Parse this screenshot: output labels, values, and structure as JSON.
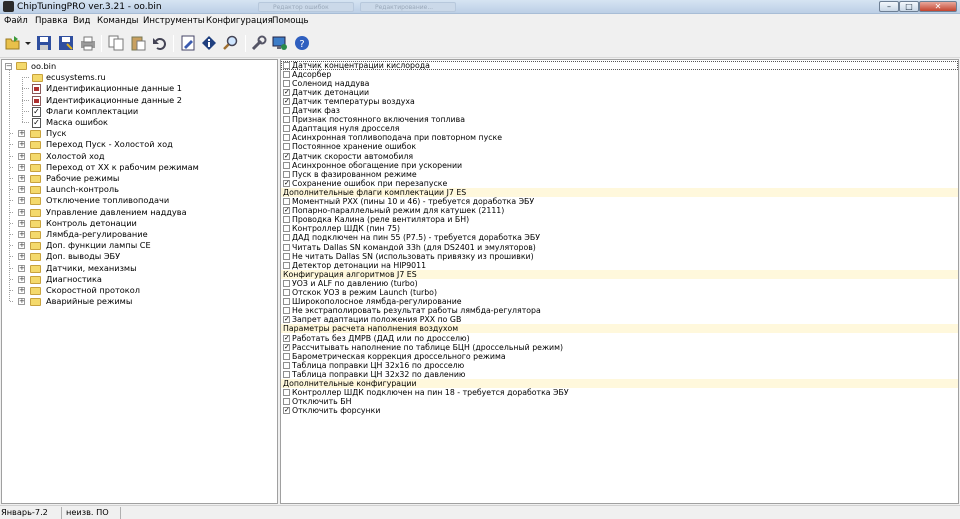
{
  "window": {
    "title": "ChipTuningPRO ver.3.21 - oo.bin",
    "ghost_tabs": [
      "Редактор ошибок",
      "Редактирование..."
    ],
    "controls": {
      "minimize": "–",
      "maximize": "□",
      "close": "✕"
    }
  },
  "menu": [
    "Файл",
    "Правка",
    "Вид",
    "Команды",
    "Инструменты",
    "Конфигурация",
    "Помощь"
  ],
  "toolbar": {
    "icons": [
      "open-icon",
      "dropdown-arrow-icon",
      "save-icon",
      "save-as-icon",
      "print-icon",
      "copy-icon",
      "paste-icon",
      "undo-icon",
      "edit-icon",
      "info-icon",
      "search-icon",
      "tools-icon",
      "monitor-icon",
      "help-icon"
    ]
  },
  "tree": {
    "root": "oo.bin",
    "children": [
      {
        "label": "ecusystems.ru",
        "kind": "folder",
        "expandable": false
      },
      {
        "label": "Идентификационные данные 1",
        "kind": "doc",
        "expandable": false
      },
      {
        "label": "Идентификационные данные 2",
        "kind": "doc",
        "expandable": false
      },
      {
        "label": "Флаги комплектации",
        "kind": "check",
        "expandable": false
      },
      {
        "label": "Маска ошибок",
        "kind": "check",
        "expandable": false
      },
      {
        "label": "Пуск",
        "kind": "folder",
        "expandable": true
      },
      {
        "label": "Переход Пуск - Холостой ход",
        "kind": "folder",
        "expandable": true
      },
      {
        "label": "Холостой ход",
        "kind": "folder",
        "expandable": true
      },
      {
        "label": "Переход от ХХ к рабочим режимам",
        "kind": "folder",
        "expandable": true
      },
      {
        "label": "Рабочие режимы",
        "kind": "folder",
        "expandable": true
      },
      {
        "label": "Launch-контроль",
        "kind": "folder",
        "expandable": true
      },
      {
        "label": "Отключение топливоподачи",
        "kind": "folder",
        "expandable": true
      },
      {
        "label": "Управление давлением наддува",
        "kind": "folder",
        "expandable": true
      },
      {
        "label": "Контроль детонации",
        "kind": "folder",
        "expandable": true
      },
      {
        "label": "Лямбда-регулирование",
        "kind": "folder",
        "expandable": true
      },
      {
        "label": "Доп. функции лампы CE",
        "kind": "folder",
        "expandable": true
      },
      {
        "label": "Доп. выводы ЭБУ",
        "kind": "folder",
        "expandable": true
      },
      {
        "label": "Датчики, механизмы",
        "kind": "folder",
        "expandable": true
      },
      {
        "label": "Диагностика",
        "kind": "folder",
        "expandable": true
      },
      {
        "label": "Скоростной протокол",
        "kind": "folder",
        "expandable": true
      },
      {
        "label": "Аварийные режимы",
        "kind": "folder",
        "expandable": true
      }
    ]
  },
  "flags": [
    {
      "type": "item",
      "label": "Датчик концентрации кислорода",
      "checked": false
    },
    {
      "type": "item",
      "label": "Адсорбер",
      "checked": false
    },
    {
      "type": "item",
      "label": "Соленоид наддува",
      "checked": false
    },
    {
      "type": "item",
      "label": "Датчик детонации",
      "checked": true
    },
    {
      "type": "item",
      "label": "Датчик температуры воздуха",
      "checked": true
    },
    {
      "type": "item",
      "label": "Датчик фаз",
      "checked": false
    },
    {
      "type": "item",
      "label": "Признак постоянного включения топлива",
      "checked": false
    },
    {
      "type": "item",
      "label": "Адаптация нуля дросселя",
      "checked": false
    },
    {
      "type": "item",
      "label": "Асинхронная топливоподача при повторном пуске",
      "checked": false
    },
    {
      "type": "item",
      "label": "Постоянное хранение ошибок",
      "checked": false
    },
    {
      "type": "item",
      "label": "Датчик скорости автомобиля",
      "checked": true
    },
    {
      "type": "item",
      "label": "Асинхронное обогащение при ускорении",
      "checked": false
    },
    {
      "type": "item",
      "label": "Пуск в фазированном режиме",
      "checked": false
    },
    {
      "type": "item",
      "label": "Сохранение ошибок при перезапуске",
      "checked": true
    },
    {
      "type": "section",
      "label": "Дополнительные флаги комплектации J7 ES"
    },
    {
      "type": "item",
      "label": "Моментный РХХ (пины 10 и 46) - требуется доработка ЭБУ",
      "checked": false
    },
    {
      "type": "item",
      "label": "Попарно-параллельный режим для катушек (2111)",
      "checked": true
    },
    {
      "type": "item",
      "label": "Проводка Калина (реле вентилятора и БН)",
      "checked": false
    },
    {
      "type": "item",
      "label": "Контроллер ШДК (пин 75)",
      "checked": false
    },
    {
      "type": "item",
      "label": "ДАД подключен на пин 55 (P7.5) - требуется доработка ЭБУ",
      "checked": false
    },
    {
      "type": "item",
      "label": "Читать Dallas SN командой 33h (для DS2401 и эмуляторов)",
      "checked": false
    },
    {
      "type": "item",
      "label": "Не читать Dallas SN (использовать привязку из прошивки)",
      "checked": false
    },
    {
      "type": "item",
      "label": "Детектор детонации на HIP9011",
      "checked": false
    },
    {
      "type": "section",
      "label": "Конфигурация алгоритмов J7 ES"
    },
    {
      "type": "item",
      "label": "УОЗ и ALF по давлению (turbo)",
      "checked": false
    },
    {
      "type": "item",
      "label": "Отскок УОЗ в режим Launch (turbo)",
      "checked": false
    },
    {
      "type": "item",
      "label": "Широкополосное лямбда-регулирование",
      "checked": false
    },
    {
      "type": "item",
      "label": "Не экстраполировать результат работы лямбда-регулятора",
      "checked": false
    },
    {
      "type": "item",
      "label": "Запрет адаптации положения РХХ по GB",
      "checked": true
    },
    {
      "type": "section",
      "label": "Параметры расчета наполнения воздухом"
    },
    {
      "type": "item",
      "label": "Работать без ДМРВ (ДАД или по дросселю)",
      "checked": true
    },
    {
      "type": "item",
      "label": "Рассчитывать наполнение по таблице БЦН (дроссельный режим)",
      "checked": true
    },
    {
      "type": "item",
      "label": "Барометрическая коррекция дроссельного режима",
      "checked": false
    },
    {
      "type": "item",
      "label": "Таблица поправки ЦН 32x16 по дросселю",
      "checked": false
    },
    {
      "type": "item",
      "label": "Таблица поправки ЦН 32x32 по давлению",
      "checked": false
    },
    {
      "type": "section",
      "label": "Дополнительные конфигурации"
    },
    {
      "type": "item",
      "label": "Контроллер ШДК подключен на пин 18 - требуется доработка ЭБУ",
      "checked": false
    },
    {
      "type": "item",
      "label": "Отключить БН",
      "checked": false
    },
    {
      "type": "item",
      "label": "Отключить форсунки",
      "checked": true
    }
  ],
  "status": {
    "panel1": "Январь-7.2",
    "panel2": "неизв. ПО",
    "panel3": ""
  }
}
